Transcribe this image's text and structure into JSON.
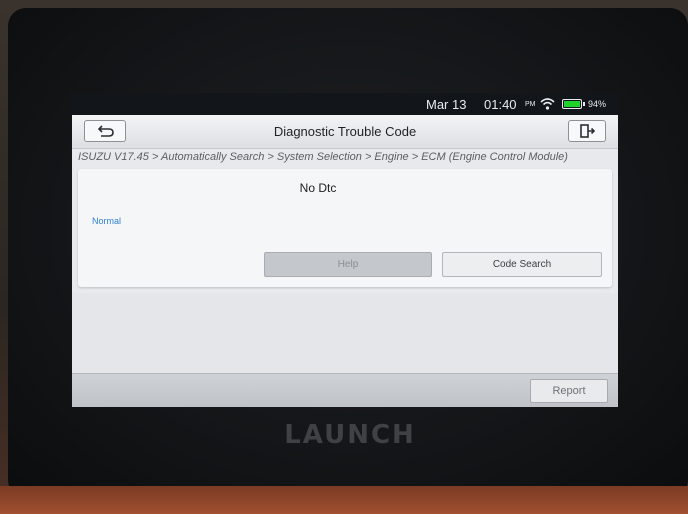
{
  "device": {
    "brand": "LAUNCH"
  },
  "statusbar": {
    "date": "Mar 13",
    "time": "01:40",
    "ampm": "PM",
    "battery_percent": "94%",
    "icons": [
      "wifi-icon",
      "battery-icon"
    ]
  },
  "header": {
    "title": "Diagnostic Trouble Code",
    "back_icon": "back-arrow-icon",
    "exit_icon": "exit-icon"
  },
  "breadcrumb": "ISUZU V17.45 > Automatically Search > System Selection > Engine > ECM (Engine Control Module)",
  "dtc": {
    "heading": "No Dtc",
    "status": "Normal"
  },
  "buttons": {
    "help": "Help",
    "code_search": "Code Search",
    "report": "Report"
  },
  "colors": {
    "status_text": "#2f7fd1",
    "battery": "#22d12c"
  }
}
